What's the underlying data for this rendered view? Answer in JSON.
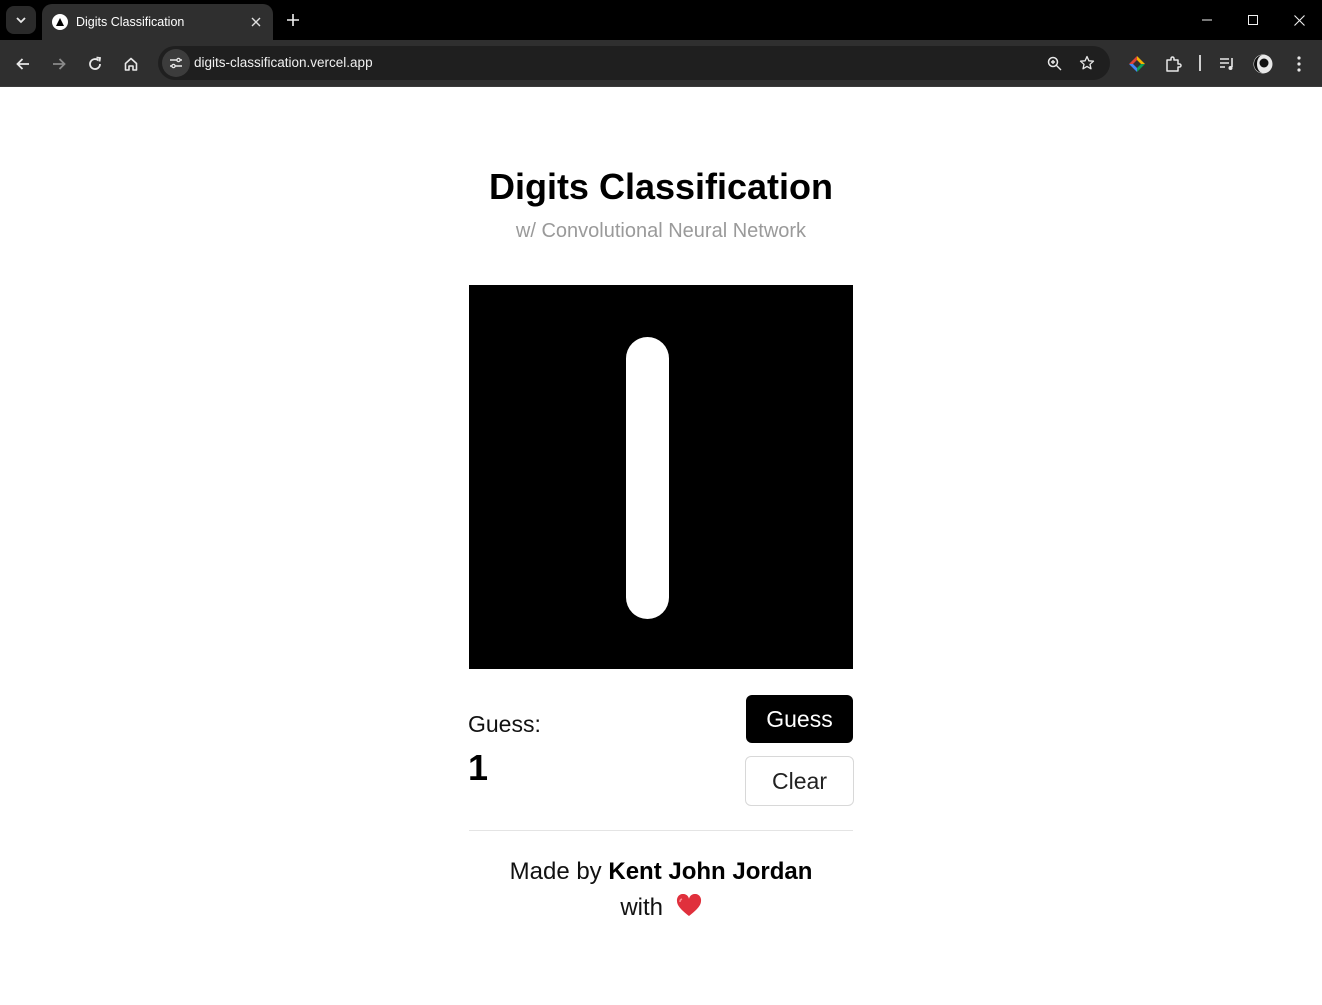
{
  "browser": {
    "tab_title": "Digits Classification",
    "url": "digits-classification.vercel.app"
  },
  "page": {
    "title": "Digits Classification",
    "subtitle": "w/ Convolutional Neural Network",
    "guess_label": "Guess:",
    "guess_value": "1",
    "guess_button": "Guess",
    "clear_button": "Clear",
    "credit_prefix": "Made by",
    "credit_name": "Kent John Jordan",
    "credit_with": "with"
  },
  "icons": {
    "tab_search": "chevron-down-icon",
    "favicon": "vercel-triangle-icon",
    "close": "close-icon",
    "new_tab": "plus-icon",
    "back": "back-arrow-icon",
    "forward": "forward-arrow-icon",
    "reload": "reload-icon",
    "home": "home-icon",
    "site_info": "tune-icon",
    "zoom": "zoom-icon",
    "bookmark": "star-icon",
    "extension_color": "colorful-diamond-icon",
    "extensions": "puzzle-icon",
    "media": "media-queue-icon",
    "profile": "avatar-icon",
    "menu": "kebab-menu-icon",
    "heart": "heart-icon"
  },
  "colors": {
    "canvas_bg": "#000000",
    "stroke": "#ffffff",
    "primary_button": "#000000",
    "subtitle": "#9a9a9a",
    "heart": "#e0303c"
  }
}
